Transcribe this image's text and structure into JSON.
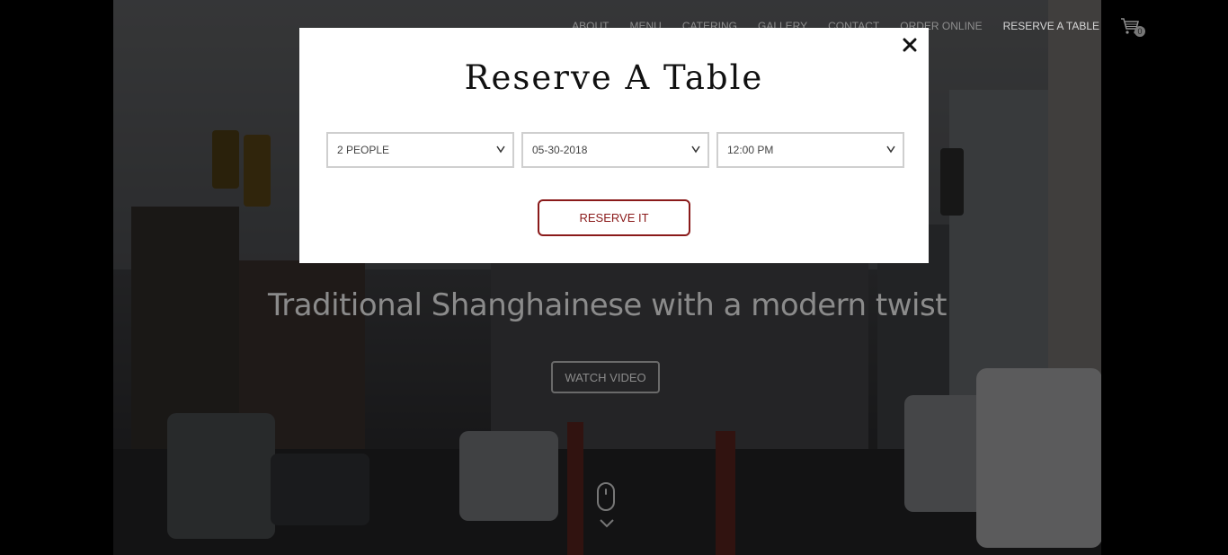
{
  "nav": {
    "items": [
      "ABOUT",
      "MENU",
      "CATERING",
      "GALLERY",
      "CONTACT",
      "ORDER ONLINE",
      "RESERVE A TABLE"
    ],
    "cart_count": "0"
  },
  "hero": {
    "tagline": "Traditional Shanghainese with a modern twist",
    "watch_video_label": "WATCH VIDEO"
  },
  "modal": {
    "title": "Reserve A Table",
    "party_size": "2 PEOPLE",
    "date": "05-30-2018",
    "time": "12:00 PM",
    "reserve_label": "RESERVE IT"
  },
  "colors": {
    "accent": "#8a1a1a",
    "modal_bg": "#ffffff",
    "overlay": "rgba(0,0,0,0.55)"
  }
}
